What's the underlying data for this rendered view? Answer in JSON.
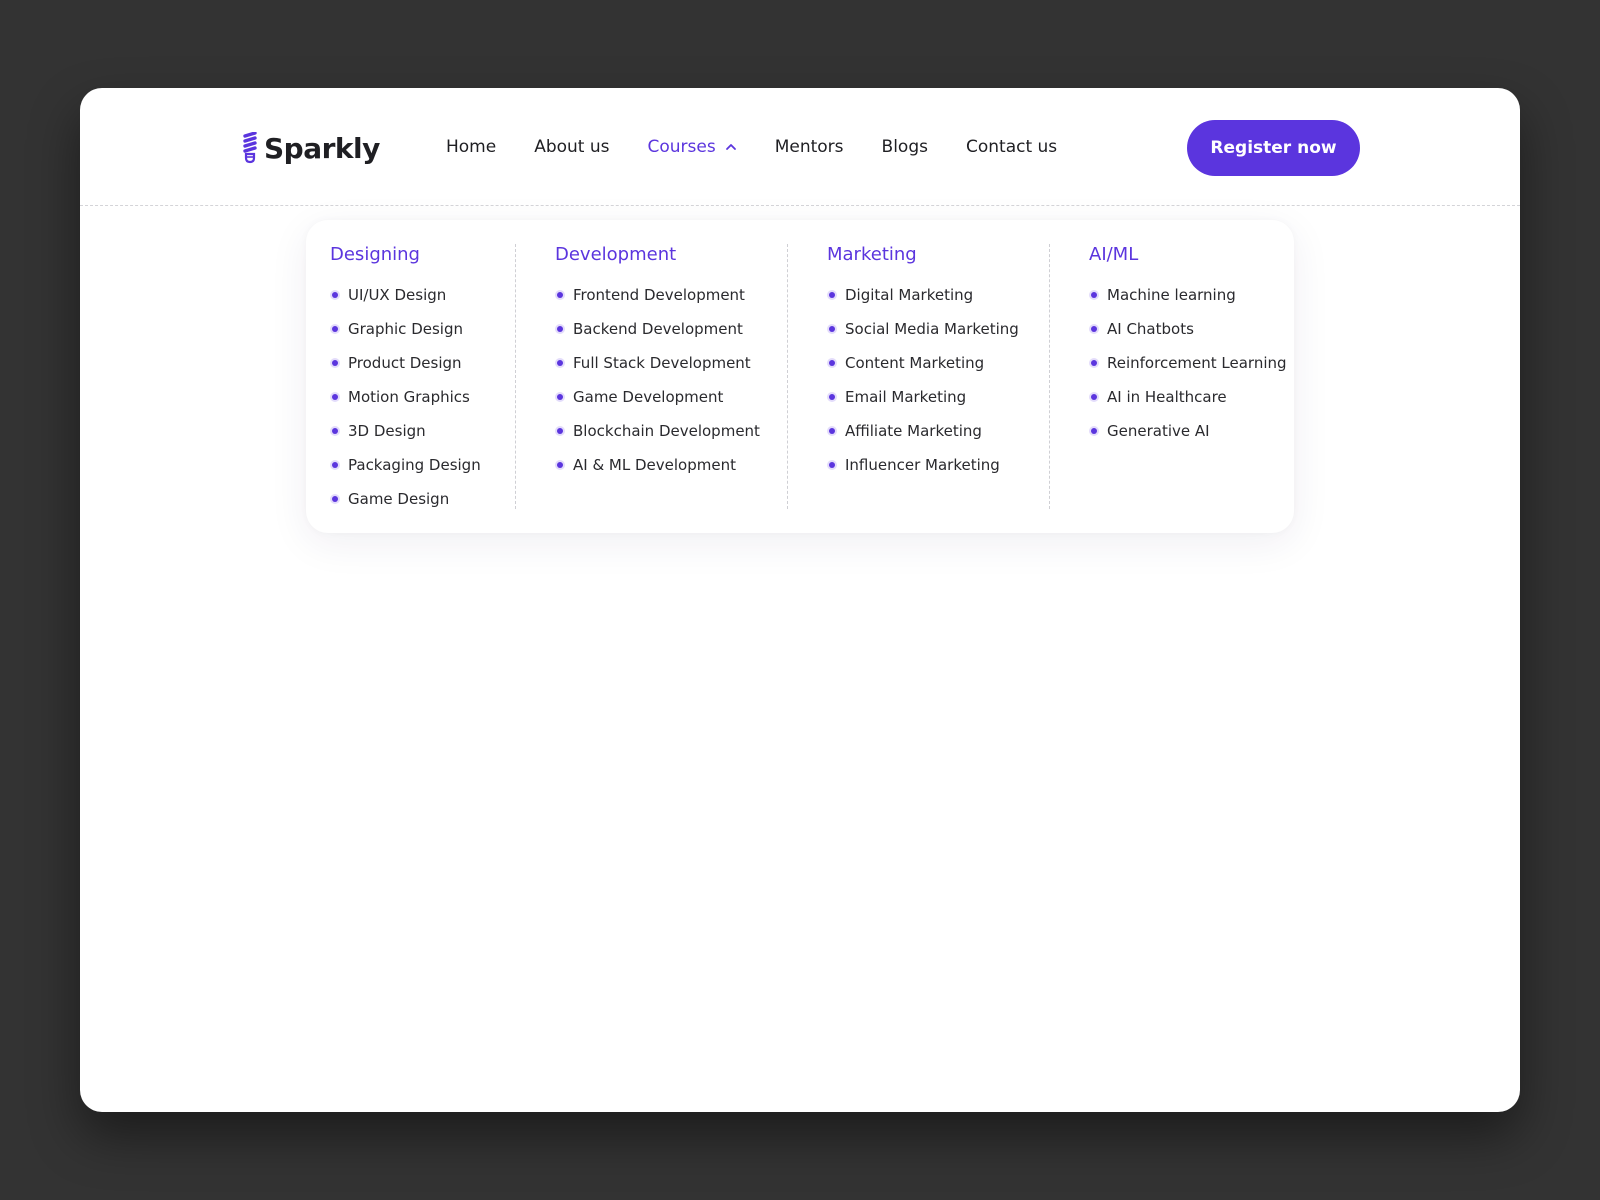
{
  "brand": {
    "name": "Sparkly",
    "accent_color": "#5b35de",
    "icon": "lightbulb-icon"
  },
  "nav": {
    "items": [
      {
        "label": "Home"
      },
      {
        "label": "About us"
      },
      {
        "label": "Courses",
        "active": true,
        "icon": "chevron-up-icon"
      },
      {
        "label": "Mentors"
      },
      {
        "label": "Blogs"
      },
      {
        "label": "Contact us"
      }
    ],
    "cta_label": "Register now"
  },
  "courses_menu": {
    "columns": [
      {
        "title": "Designing",
        "items": [
          "UI/UX Design",
          "Graphic Design",
          "Product Design",
          "Motion Graphics",
          "3D Design",
          "Packaging Design",
          "Game Design"
        ]
      },
      {
        "title": "Development",
        "items": [
          "Frontend Development",
          "Backend Development",
          "Full Stack Development",
          "Game Development",
          "Blockchain Development",
          "AI & ML Development"
        ]
      },
      {
        "title": "Marketing",
        "items": [
          "Digital Marketing",
          "Social Media Marketing",
          "Content Marketing",
          "Email Marketing",
          "Affiliate Marketing",
          "Influencer Marketing"
        ]
      },
      {
        "title": "AI/ML",
        "items": [
          "Machine learning",
          "AI Chatbots",
          "Reinforcement Learning",
          "AI in Healthcare",
          "Generative AI"
        ]
      }
    ]
  }
}
